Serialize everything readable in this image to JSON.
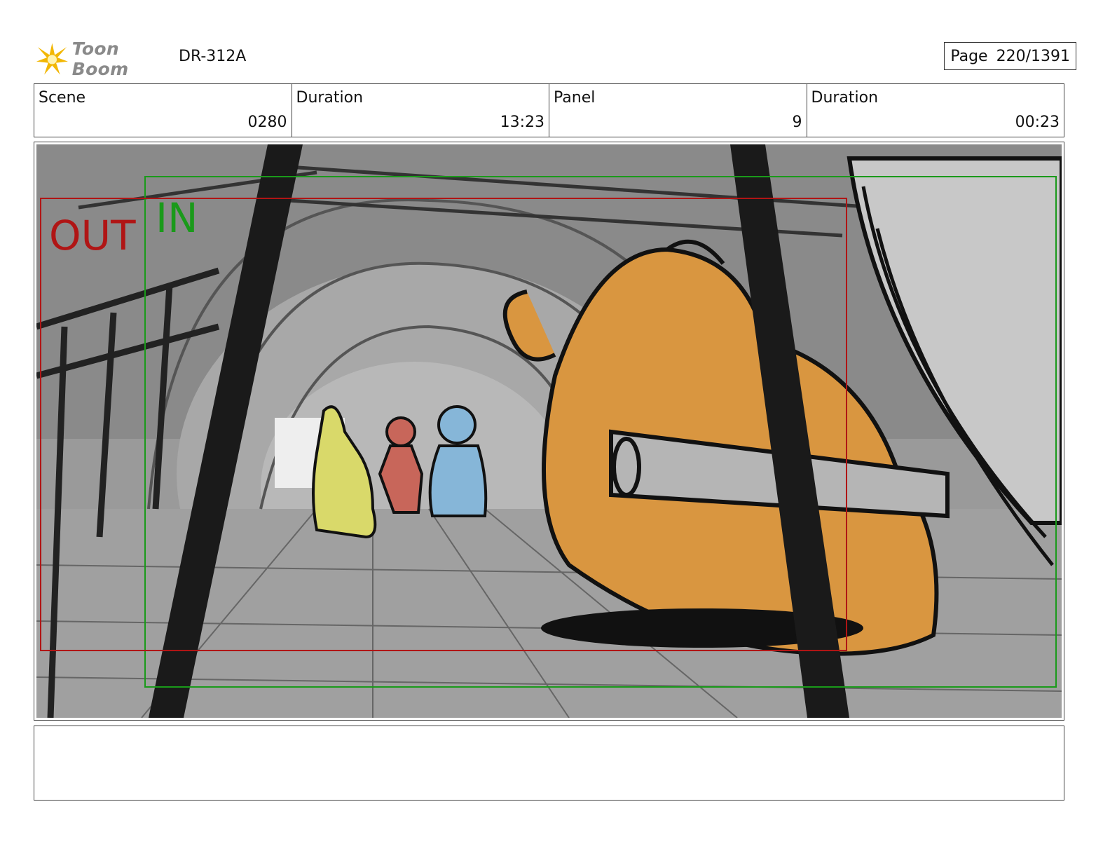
{
  "header": {
    "logo_text": "Toon Boom",
    "doc_id": "DR-312A",
    "page_label": "Page",
    "page_value": "220/1391"
  },
  "info": {
    "scene_label": "Scene",
    "scene_value": "0280",
    "duration_label": "Duration",
    "duration_value": "13:23",
    "panel_label": "Panel",
    "panel_value": "9",
    "panel_duration_label": "Duration",
    "panel_duration_value": "00:23"
  },
  "frame": {
    "out_label": "OUT",
    "in_label": "IN",
    "out_color": "#b01515",
    "in_color": "#1a9a1a"
  },
  "colors": {
    "yellow_char": "#d9d96a",
    "red_char": "#c8665a",
    "blue_char": "#86b6d8",
    "orange_creature": "#d99640"
  },
  "notes": {
    "text": ""
  }
}
